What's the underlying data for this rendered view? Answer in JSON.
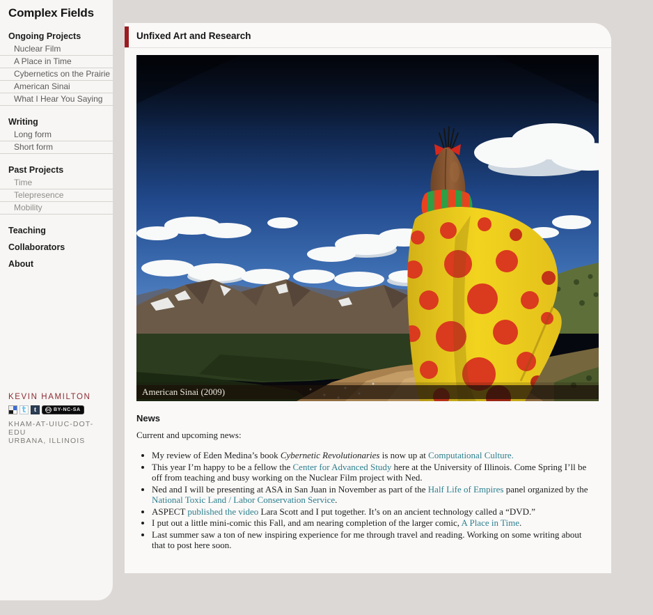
{
  "colors": {
    "page_bg": "#dcd8d6",
    "sidebar_bg": "#f7f6f4",
    "content_bg": "#faf9f8",
    "accent_red": "#9a1b20",
    "name_red": "#8e2b33",
    "link_teal": "#2d7f8d"
  },
  "sidebar": {
    "title": "Complex Fields",
    "sections": [
      {
        "heading": "Ongoing Projects",
        "muted": false,
        "items": [
          "Nuclear Film",
          "A Place in Time",
          "Cybernetics on the Prairie",
          "American Sinai",
          "What I Hear You Saying"
        ]
      },
      {
        "heading": "Writing",
        "muted": false,
        "items": [
          "Long form",
          "Short form"
        ]
      },
      {
        "heading": "Past Projects",
        "muted": true,
        "items": [
          "Time",
          "Telepresence",
          "Mobility"
        ]
      },
      {
        "heading": "Teaching",
        "muted": false,
        "items": []
      },
      {
        "heading": "Collaborators",
        "muted": false,
        "items": []
      },
      {
        "heading": "About",
        "muted": false,
        "items": []
      }
    ],
    "footer": {
      "name": "KEVIN HAMILTON",
      "icons": [
        "delicious-icon",
        "twitter-icon",
        "tumblr-icon",
        "cc-license-badge"
      ],
      "twitter_glyph": "t",
      "tumblr_glyph": "t",
      "cc_circle": "cc",
      "cc_badge_text": "BY-NC-SA",
      "contact_line1": "KHAM-AT-UIUC-DOT-EDU",
      "contact_line2": "URBANA, ILLINOIS"
    }
  },
  "header": {
    "title": "Unfixed Art and Research"
  },
  "photo": {
    "caption": "American Sinai (2009)"
  },
  "news": {
    "heading": "News",
    "intro": "Current and upcoming news:",
    "items": [
      [
        {
          "t": "My review of Eden Medina’s book "
        },
        {
          "t": "Cybernetic Revolutionaries",
          "s": "italic"
        },
        {
          "t": " is now up at "
        },
        {
          "t": "Computational Culture.",
          "s": "link"
        }
      ],
      [
        {
          "t": "This year I’m happy to be a fellow the "
        },
        {
          "t": "Center for Advanced Study",
          "s": "link"
        },
        {
          "t": " here at the University of Illinois. Come Spring I’ll be off from teaching and busy working on the Nuclear Film project with Ned."
        }
      ],
      [
        {
          "t": "Ned and I will be presenting at ASA in San Juan in November as part of the "
        },
        {
          "t": "Half Life of Empires",
          "s": "link"
        },
        {
          "t": " panel organized by the "
        },
        {
          "t": "National Toxic Land / Labor Conservation Service",
          "s": "link"
        },
        {
          "t": "."
        }
      ],
      [
        {
          "t": "ASPECT "
        },
        {
          "t": "published the video",
          "s": "link"
        },
        {
          "t": " Lara Scott and I put together. It’s on an ancient technology called a “DVD.”"
        }
      ],
      [
        {
          "t": "I put out a little mini-comic this Fall, and am nearing completion of the larger comic, "
        },
        {
          "t": "A Place in Time",
          "s": "link"
        },
        {
          "t": "."
        }
      ],
      [
        {
          "t": "Last summer saw a ton of new inspiring experience for me through travel and reading. Working on some writing about that to post here soon."
        }
      ]
    ]
  }
}
